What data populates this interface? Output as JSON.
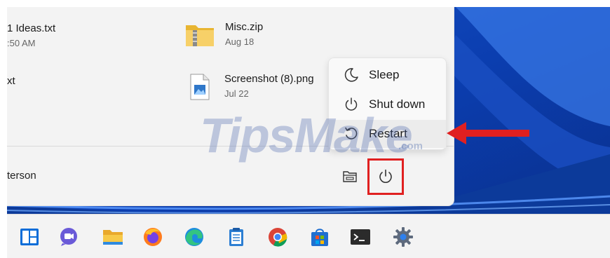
{
  "files": [
    {
      "name": "1 Ideas.txt",
      "date": ":50 AM"
    },
    {
      "name": "xt",
      "date": ""
    },
    {
      "name": "Misc.zip",
      "date": "Aug 18"
    },
    {
      "name": "Screenshot (8).png",
      "date": "Jul 22"
    }
  ],
  "user": {
    "name": "terson"
  },
  "power_menu": {
    "items": [
      {
        "label": "Sleep",
        "icon": "moon-icon"
      },
      {
        "label": "Shut down",
        "icon": "power-icon"
      },
      {
        "label": "Restart",
        "icon": "restart-icon"
      }
    ]
  },
  "watermark": {
    "text": "TipsMake",
    "suffix": ".com"
  },
  "taskbar": {
    "icons": [
      "start-icon",
      "chat-icon",
      "file-explorer-icon",
      "firefox-icon",
      "edge-icon",
      "notepad-icon",
      "chrome-icon",
      "store-icon",
      "terminal-icon",
      "settings-icon"
    ]
  },
  "colors": {
    "highlight": "#e02020",
    "accent": "#0067c0",
    "arrow": "#e02020"
  }
}
